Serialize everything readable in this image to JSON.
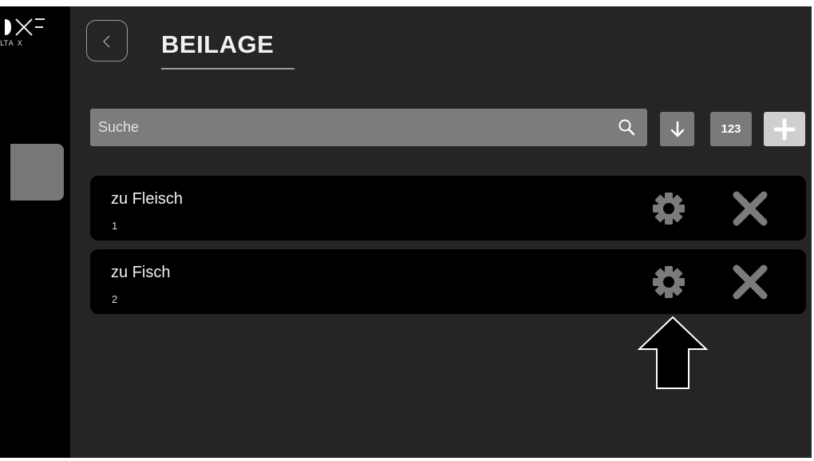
{
  "app": {
    "logo_text": "LTA X"
  },
  "header": {
    "title": "BEILAGE",
    "back_icon": "chevron-left-icon"
  },
  "search": {
    "placeholder": "Suche",
    "value": "",
    "icon": "search-icon"
  },
  "toolbar": {
    "sort_icon": "arrow-down-icon",
    "number_label": "123",
    "add_icon": "plus-icon"
  },
  "items": [
    {
      "name": "zu Fleisch",
      "number": "1",
      "settings_icon": "gear-icon",
      "delete_icon": "close-icon"
    },
    {
      "name": "zu Fisch",
      "number": "2",
      "settings_icon": "gear-icon",
      "delete_icon": "close-icon"
    }
  ],
  "annotation": {
    "icon": "up-arrow-icon",
    "points_to": "items.1.settings"
  },
  "colors": {
    "background": "#252525",
    "sidebar": "#000000",
    "search_bg": "#7c7c7c",
    "button_bg": "#7a7a7a",
    "add_button_bg": "#cfcfcf",
    "icon_gray": "#7b7b7b",
    "text": "#f0f0f0"
  }
}
